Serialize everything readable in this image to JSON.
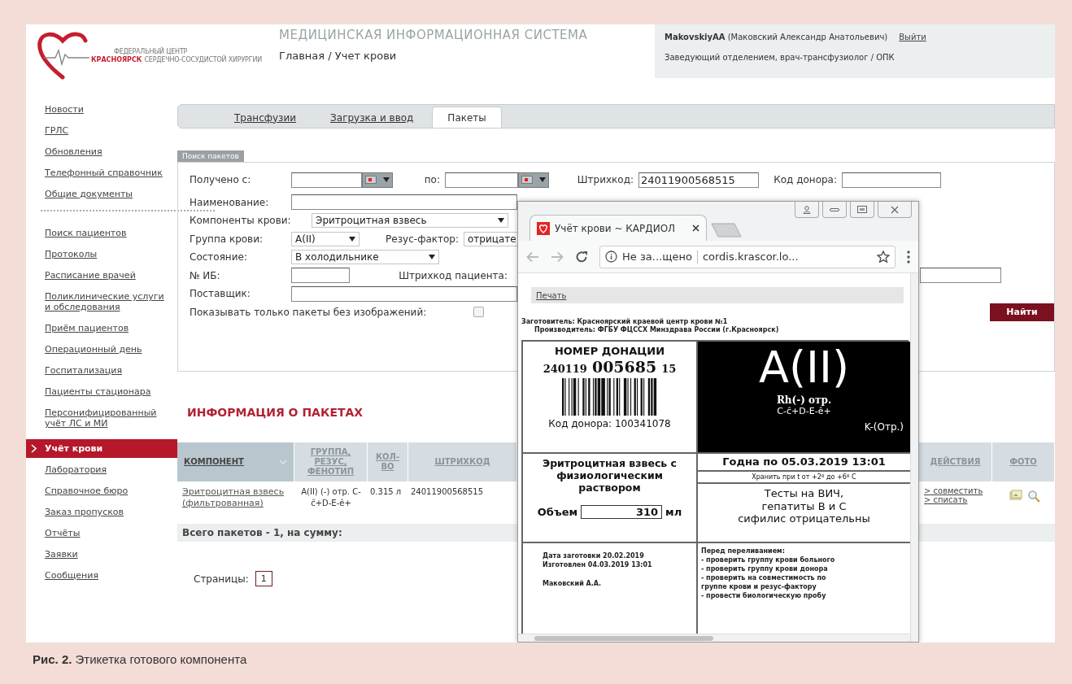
{
  "header": {
    "logo": {
      "line_1": "ФЕДЕРАЛЬНЫЙ ЦЕНТР",
      "city": "КРАСНОЯРСК",
      "line_2": "СЕРДЕЧНО-СОСУДИСТОЙ ХИРУРГИИ"
    },
    "system_title": "МЕДИЦИНСКАЯ ИНФОРМАЦИОННАЯ СИСТЕМА",
    "breadcrumb": "Главная / Учет крови",
    "user": {
      "name": "**MakovskiyAA** (Маковский Александр Анатольевич)",
      "logout": "Выйти",
      "role": "Заведующий отделением, врач-трансфузиолог / ОПК"
    }
  },
  "sidebar": {
    "groups": [
      {
        "items": [
          {
            "label": "Новости",
            "selected": false
          },
          {
            "label": "ГРЛС",
            "selected": false
          },
          {
            "label": "Обновления",
            "selected": false
          },
          {
            "label": "Телефонный справочник",
            "selected": false
          },
          {
            "label": "Общие документы",
            "selected": false
          }
        ]
      },
      {
        "items": [
          {
            "label": "Поиск пациентов",
            "selected": false
          },
          {
            "label": "Протоколы",
            "selected": false
          },
          {
            "label": "Расписание врачей",
            "selected": false
          },
          {
            "label": "Поликлинические услуги и обследования",
            "selected": false
          },
          {
            "label": "Приём пациентов",
            "selected": false
          },
          {
            "label": "Операционный день",
            "selected": false
          },
          {
            "label": "Госпитализация",
            "selected": false
          },
          {
            "label": "Пациенты стационара",
            "selected": false
          },
          {
            "label": "Персонифицированный учёт ЛС и МИ",
            "selected": false
          },
          {
            "label": "Учёт крови",
            "selected": true
          },
          {
            "label": "Лаборатория",
            "selected": false
          },
          {
            "label": "Справочное бюро",
            "selected": false
          },
          {
            "label": "Заказ пропусков",
            "selected": false
          },
          {
            "label": "Отчёты",
            "selected": false
          },
          {
            "label": "Заявки",
            "selected": false
          },
          {
            "label": "Сообщения",
            "selected": false
          }
        ]
      }
    ]
  },
  "tabs": [
    {
      "label": "Трансфузии",
      "selected": false
    },
    {
      "label": "Загрузка и ввод",
      "selected": false
    },
    {
      "label": "Пакеты",
      "selected": true
    }
  ],
  "search": {
    "title": "Поиск пакетов",
    "rows": [
      {
        "left": [
          {
            "kind": "label",
            "text": "Получено с:"
          },
          {
            "kind": "date"
          },
          {
            "kind": "label",
            "text": "по:"
          },
          {
            "kind": "date"
          },
          {
            "kind": "label",
            "text": "Штрихкод:"
          },
          {
            "kind": "input",
            "value": "24011900568515"
          },
          {
            "kind": "label",
            "text": "Код донора:"
          },
          {
            "kind": "input"
          }
        ]
      },
      {
        "left": [
          {
            "kind": "label",
            "text": "Наименование:"
          },
          {
            "kind": "input"
          }
        ]
      },
      {
        "left": [
          {
            "kind": "label",
            "text": "Компоненты крови:"
          },
          {
            "kind": "select",
            "value": "Эритроцитная взвесь"
          }
        ]
      },
      {
        "left": [
          {
            "kind": "label",
            "text": "Группа крови:"
          },
          {
            "kind": "select",
            "value": "A(II)"
          },
          {
            "kind": "label",
            "text": "Резус-фактор:"
          },
          {
            "kind": "clipped",
            "value": "отрицате"
          }
        ]
      },
      {
        "left": [
          {
            "kind": "label",
            "text": "Состояние:"
          },
          {
            "kind": "select",
            "value": "В холодильнике"
          }
        ]
      },
      {
        "left": [
          {
            "kind": "label",
            "text": "№ ИБ:"
          },
          {
            "kind": "input"
          },
          {
            "kind": "label",
            "text": "Штрихкод пациента:"
          }
        ],
        "right": [
          {
            "kind": "input"
          }
        ]
      },
      {
        "left": [
          {
            "kind": "label",
            "text": "Поставщик:"
          },
          {
            "kind": "input"
          }
        ]
      },
      {
        "left": [
          {
            "kind": "label",
            "text": "Показывать только пакеты без изображений:"
          },
          {
            "kind": "checkbox",
            "checked": false
          }
        ],
        "right": [
          {
            "kind": "button",
            "text": "Найти"
          }
        ]
      }
    ]
  },
  "packages": {
    "title": "ИНФОРМАЦИЯ О ПАКЕТАХ",
    "columns": [
      "КОМПОНЕНТ",
      "ГРУППА, РЕЗУС, ФЕНОТИП",
      "КОЛ-ВО",
      "ШТРИХКОД"
    ],
    "right_columns": [
      "ДЕЙСТВИЯ",
      "ФОТО"
    ],
    "rows": [
      {
        "component": "Эритроцитная взвесь (фильтрованная)",
        "group": "A(II) (-) отр. C-ĉ+D-E-ê+",
        "amount": "0.315 л",
        "barcode": "24011900568515",
        "actions": [
          "> совместить",
          "> списать"
        ]
      }
    ],
    "total": "Всего пакетов - 1, на сумму:",
    "pages_label": "Страницы:",
    "pages": [
      {
        "label": "1",
        "selected": true
      }
    ]
  },
  "popup": {
    "tab_title": "Учёт крови ~ КАРДИОЛ",
    "security": "Не за...щено",
    "url": "cordis.krascor.lo...",
    "print_link": "Печать",
    "label": {
      "procurer": "Заготовитель: Красноярский краевой центр крови №1",
      "producer": "Производитель: ФГБУ ФЦССХ Минздрава России (г.Красноярск)",
      "donation_title": "НОМЕР ДОНАЦИИ",
      "donation_prefix": "240119",
      "donation_number": "005685",
      "donation_suffix": "15",
      "donor_code": "Код донора: 100341078",
      "blood_group": "A(II)",
      "rh": "Rh(-) отр.",
      "phenotype": "C-ĉ+D-E-ê+",
      "kell": "K-(Отр.)",
      "component": "Эритроцитная взвесь с физиологическим раствором",
      "volume_label": "Объем",
      "volume": "310",
      "volume_unit": "мл",
      "expiry": "Годна по 05.03.2019 13:01",
      "storage": "Хранить при t от +2º до +6º С",
      "tests": [
        "Тесты на ВИЧ,",
        "гепатиты В и С",
        "сифилис отрицательны"
      ],
      "dates": [
        "Дата заготовки 20.02.2019",
        "Изготовлен 04.03.2019 13:01"
      ],
      "signature": "Маковский А.А.",
      "instructions": [
        "Перед переливанием:",
        "- проверить группу крови больного",
        "- проверить группу крови донора",
        "- проверить на совместимость по группе крови и резус-фактору",
        "- провести биологическую пробу"
      ]
    }
  },
  "caption": "**Рис. 2.** Этикетка готового компонента"
}
